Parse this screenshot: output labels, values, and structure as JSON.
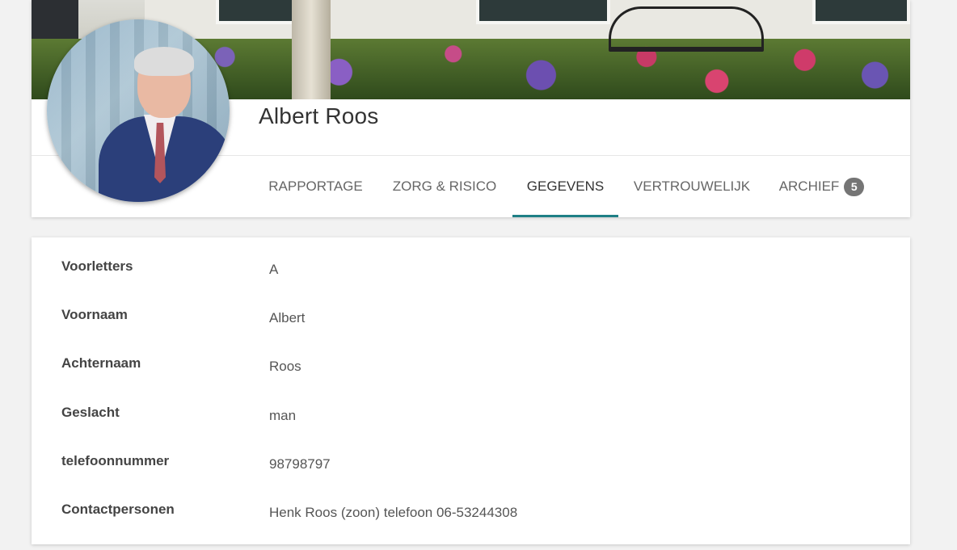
{
  "profile": {
    "name": "Albert Roos"
  },
  "tabs": [
    {
      "label": "RAPPORTAGE"
    },
    {
      "label": "ZORG & RISICO"
    },
    {
      "label": "GEGEVENS",
      "active": true
    },
    {
      "label": "VERTROUWELIJK"
    },
    {
      "label": "ARCHIEF",
      "badge": "5"
    }
  ],
  "details": [
    {
      "label": "Voorletters",
      "value": "A"
    },
    {
      "label": "Voornaam",
      "value": "Albert"
    },
    {
      "label": "Achternaam",
      "value": "Roos"
    },
    {
      "label": "Geslacht",
      "value": "man"
    },
    {
      "label": "telefoonnummer",
      "value": "98798797"
    },
    {
      "label": "Contactpersonen",
      "value": "Henk Roos (zoon) telefoon 06-53244308"
    }
  ],
  "colors": {
    "accent": "#1e7f86",
    "badge": "#757575"
  }
}
